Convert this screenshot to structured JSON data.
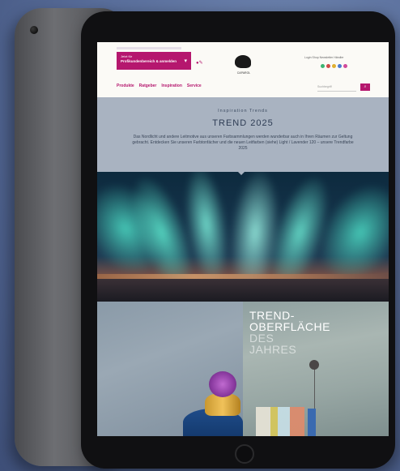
{
  "header": {
    "promo_small": "Jetzt für",
    "promo_main": "Profikundenbereich & anmelden",
    "logo_text": "CAPAROL",
    "utility_links": "Login   Shop   Newsletter   Händler",
    "swatch_colors": [
      "#3cb371",
      "#d04848",
      "#e0b030",
      "#4a7ad0",
      "#d04a9a"
    ]
  },
  "nav": {
    "items": [
      "Produkte",
      "Ratgeber",
      "Inspiration",
      "Service"
    ],
    "search_placeholder": "Suchbegriff",
    "search_button_icon": "search-icon"
  },
  "trend": {
    "eyebrow": "Inspiration  Trends",
    "title": "TREND 2025",
    "description": "Das Nordlicht und andere Leitmotive aus unseren Farbsammlungen werden wunderbar auch in Ihren Räumen zur Geltung gebracht. Entdecken Sie unseren Farbtonfächer und die neuen Leitfarben (siehe) Light / Lavender 120 – unsere Trendfarbe 2025"
  },
  "surface": {
    "line1": "TREND-",
    "line2": "OBERFLÄCHE",
    "line3": "DES",
    "line4": "JAHRES"
  },
  "colors": {
    "brand": "#b5176e",
    "intro_bg": "#a9b3c1"
  }
}
